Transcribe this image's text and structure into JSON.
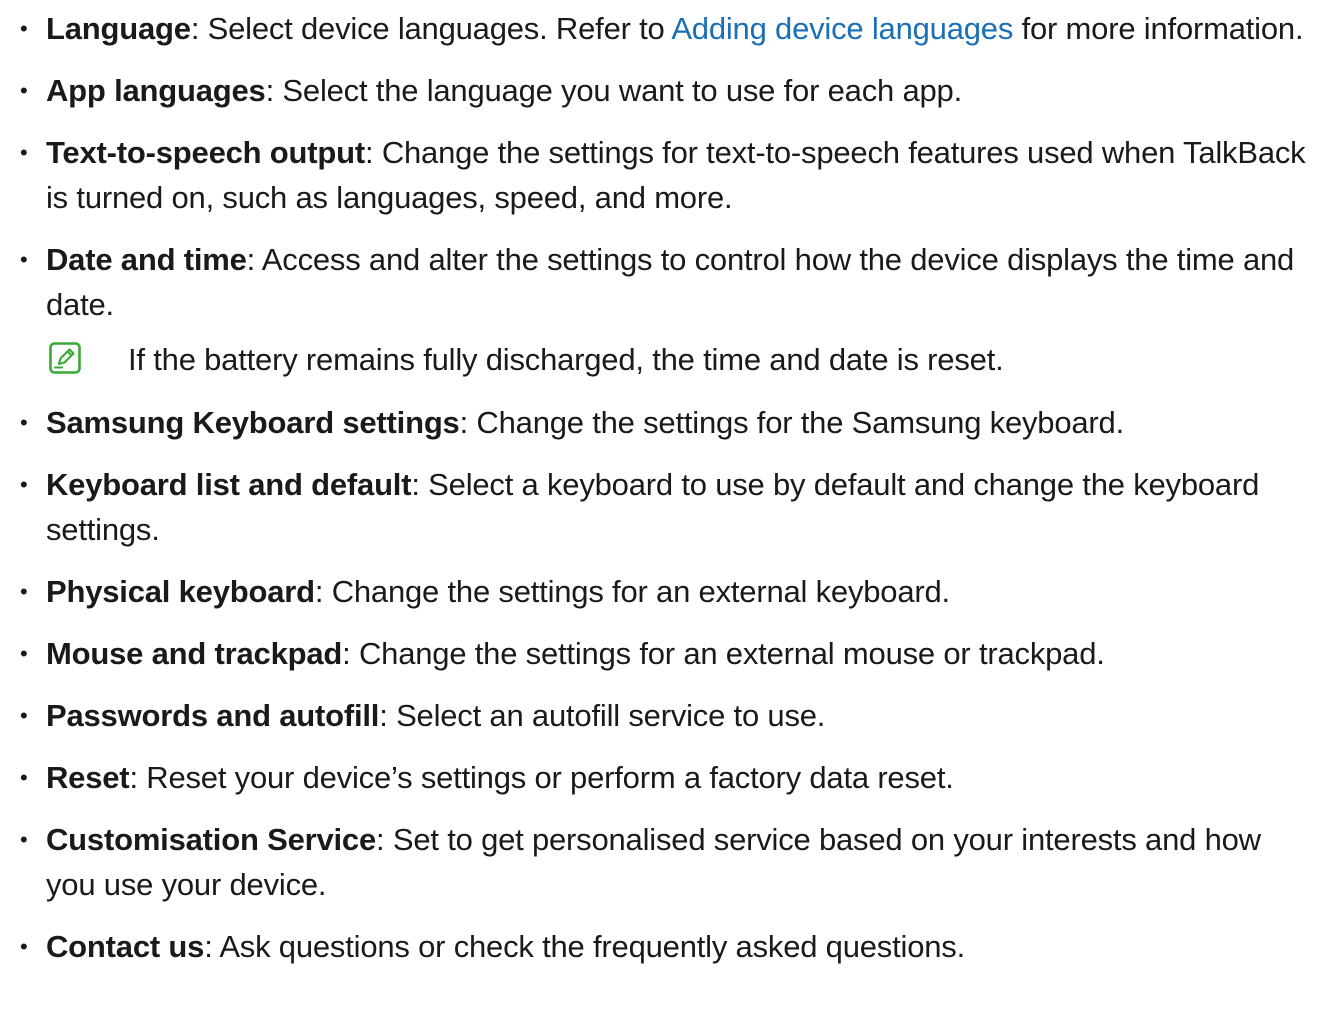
{
  "items": [
    {
      "term": "Language",
      "sep": ": ",
      "text_before": "Select device languages. Refer to ",
      "link": "Adding device languages",
      "text_after": " for more information."
    },
    {
      "term": "App languages",
      "sep": ": ",
      "text": "Select the language you want to use for each app."
    },
    {
      "term": "Text-to-speech output",
      "sep": ": ",
      "text": "Change the settings for text-to-speech features used when TalkBack is turned on, such as languages, speed, and more."
    },
    {
      "term": "Date and time",
      "sep": ": ",
      "text": "Access and alter the settings to control how the device displays the time and date."
    },
    {
      "term": "Samsung Keyboard settings",
      "sep": ": ",
      "text": "Change the settings for the Samsung keyboard."
    },
    {
      "term": "Keyboard list and default",
      "sep": ": ",
      "text": "Select a keyboard to use by default and change the keyboard settings."
    },
    {
      "term": "Physical keyboard",
      "sep": ": ",
      "text": "Change the settings for an external keyboard."
    },
    {
      "term": "Mouse and trackpad",
      "sep": ": ",
      "text": "Change the settings for an external mouse or trackpad."
    },
    {
      "term": "Passwords and autofill",
      "sep": ": ",
      "text": "Select an autofill service to use."
    },
    {
      "term": "Reset",
      "sep": ": ",
      "text": "Reset your device’s settings or perform a factory data reset."
    },
    {
      "term": "Customisation Service",
      "sep": ": ",
      "text": "Set to get personalised service based on your interests and how you use your device."
    },
    {
      "term": "Contact us",
      "sep": ": ",
      "text": "Ask questions or check the frequently asked questions."
    }
  ],
  "note": {
    "icon": "note-pencil-icon",
    "text": "If the battery remains fully discharged, the time and date is reset.",
    "icon_color": "#3aa935"
  },
  "bullet_char": "•",
  "colors": {
    "text": "#1a1a1a",
    "link": "#1a6fb6"
  }
}
